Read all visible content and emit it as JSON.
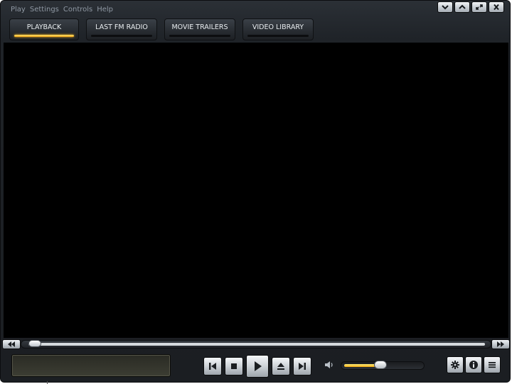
{
  "menu": {
    "items": [
      {
        "label": "Play"
      },
      {
        "label": "Settings"
      },
      {
        "label": "Controls"
      },
      {
        "label": "Help"
      }
    ]
  },
  "window_controls": {
    "icons": [
      "chevron-down-icon",
      "chevron-up-icon",
      "restore-icon",
      "close-icon"
    ]
  },
  "tabs": [
    {
      "label": "PLAYBACK",
      "active": true
    },
    {
      "label": "LAST FM RADIO",
      "active": false
    },
    {
      "label": "MOVIE TRAILERS",
      "active": false
    },
    {
      "label": "VIDEO LIBRARY",
      "active": false
    }
  ],
  "seek": {
    "position_fraction": 0.0
  },
  "display": {
    "text": ""
  },
  "transport": {
    "icons": [
      "skip-back-icon",
      "stop-icon",
      "play-icon",
      "eject-icon",
      "skip-forward-icon"
    ]
  },
  "volume": {
    "level_fraction": 0.47
  },
  "colors": {
    "accent": "#f2a416",
    "video_background": "#000000",
    "chrome": "#1f2328"
  }
}
